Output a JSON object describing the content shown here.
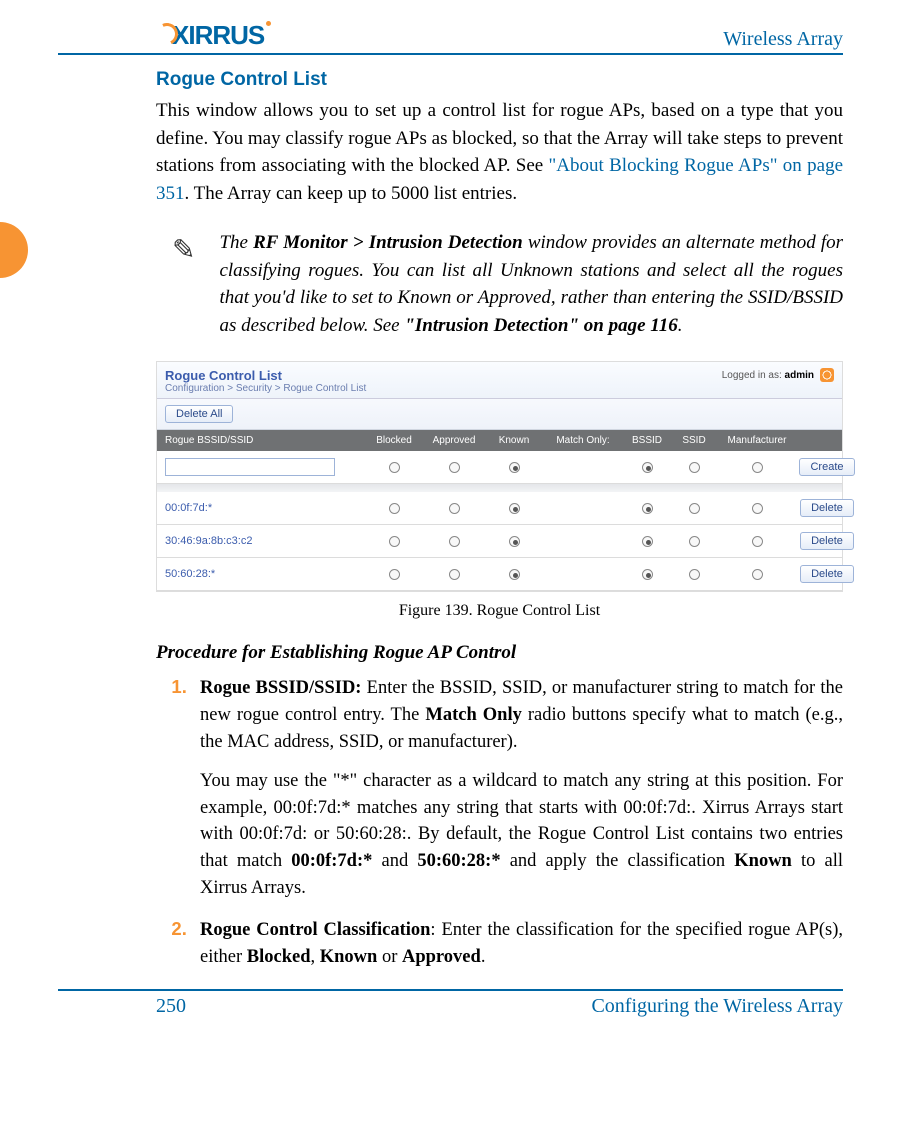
{
  "header": {
    "logo_text": "XIRRUS",
    "right_text": "Wireless Array"
  },
  "section": {
    "title": "Rogue Control List",
    "para1_a": "This window allows you to set up a control list for rogue APs, based on a type that you define. You may classify rogue APs as blocked, so that the Array will take steps to prevent stations from associating with the blocked AP. See ",
    "para1_link": "\"About Blocking Rogue APs\" on page 351",
    "para1_b": ". The Array can keep up to 5000 list entries."
  },
  "note": {
    "a": "The ",
    "b": "RF Monitor > Intrusion Detection",
    "c": " window provides an alternate method for classifying rogues. You can list all Unknown stations and select all the rogues that you'd like to set to Known or Approved, rather than entering the SSID/BSSID as described below. See ",
    "d": "\"Intrusion Detection\" on page 116",
    "e": "."
  },
  "screenshot": {
    "title": "Rogue Control List",
    "breadcrumb": "Configuration > Security > Rogue Control List",
    "login_prefix": "Logged in as: ",
    "login_user": "admin",
    "delete_all_btn": "Delete All",
    "headers": {
      "c0": "Rogue BSSID/SSID",
      "c1": "Blocked",
      "c2": "Approved",
      "c3": "Known",
      "c4": "Match Only:",
      "c5": "BSSID",
      "c6": "SSID",
      "c7": "Manufacturer"
    },
    "create_btn": "Create",
    "delete_btn": "Delete",
    "rows": [
      {
        "id": "00:0f:7d:*"
      },
      {
        "id": "30:46:9a:8b:c3:c2"
      },
      {
        "id": "50:60:28:*"
      }
    ]
  },
  "figure_caption": "Figure 139. Rogue Control List",
  "procedure": {
    "heading": "Procedure for Establishing Rogue AP Control",
    "item1": {
      "label": "Rogue BSSID/SSID:",
      "p1": " Enter the BSSID, SSID, or manufacturer string to match for the new rogue control entry. The ",
      "bold1": "Match Only",
      "p1b": " radio buttons specify what to match (e.g., the MAC address, SSID, or manufacturer).",
      "p2a": "You may use the \"*\" character as a wildcard to match any string at this position. For example, 00:0f:7d:* matches any string that starts with 00:0f:7d:. Xirrus Arrays start with 00:0f:7d: or 50:60:28:. By default, the Rogue Control List contains two entries that match ",
      "p2b1": "00:0f:7d:*",
      "p2c": " and ",
      "p2b2": "50:60:28:*",
      "p2d": " and apply the classification ",
      "p2b3": "Known",
      "p2e": " to all Xirrus Arrays."
    },
    "item2": {
      "label": "Rogue Control Classification",
      "p1": ": Enter the classification for the specified rogue AP(s), either ",
      "b1": "Blocked",
      "c1": ", ",
      "b2": "Known",
      "c2": " or ",
      "b3": "Approved",
      "c3": "."
    }
  },
  "footer": {
    "page_number": "250",
    "section_name": "Configuring the Wireless Array"
  }
}
